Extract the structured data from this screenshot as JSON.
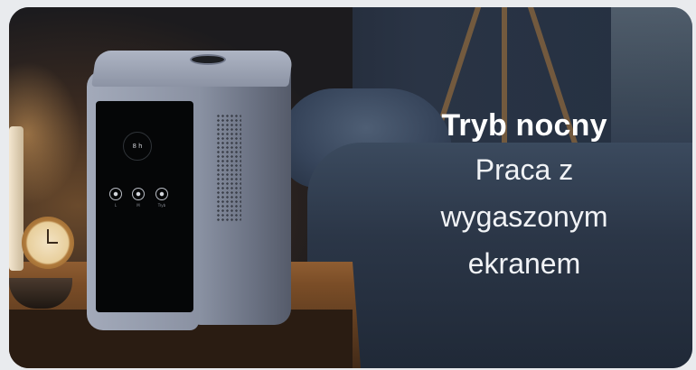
{
  "slide": {
    "title": "Tryb nocny",
    "subtitle_lines": [
      "Praca z",
      "wygaszonym",
      "ekranem"
    ]
  },
  "device": {
    "display_text": "8 h",
    "control_labels": [
      "L",
      "M",
      "Tryb"
    ]
  },
  "colors": {
    "text": "#ffffff",
    "background_dark": "#202734",
    "device_body": "#8f97a8"
  }
}
